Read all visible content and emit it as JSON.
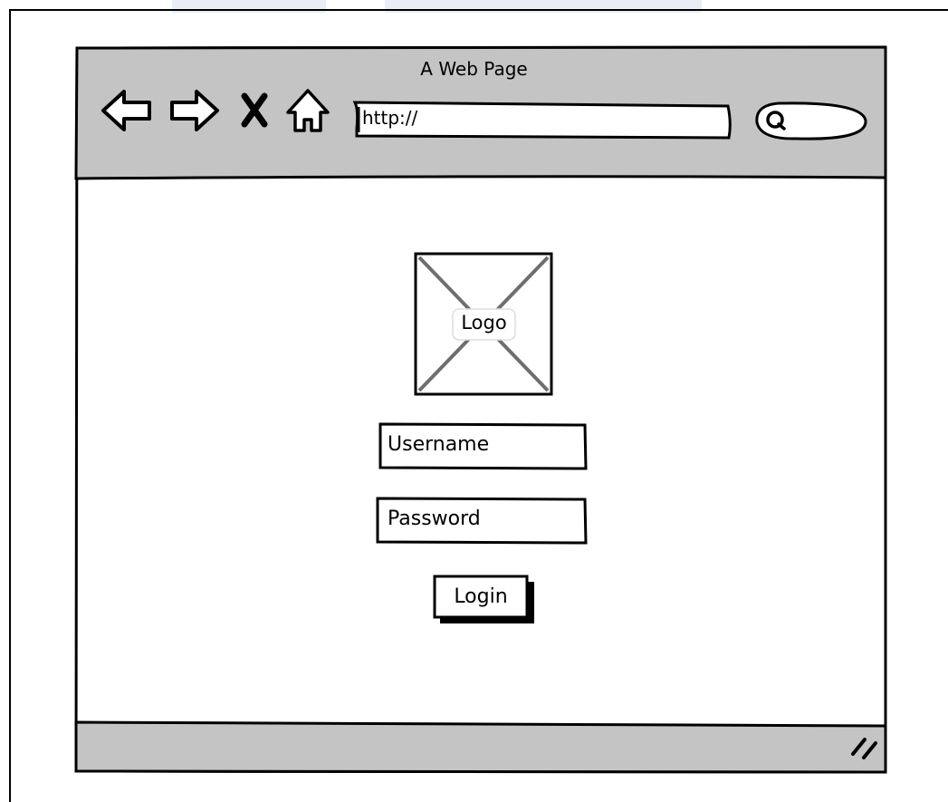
{
  "window": {
    "title": "A Web Page"
  },
  "toolbar": {
    "address": "http://",
    "icons": [
      "back-arrow-icon",
      "forward-arrow-icon",
      "close-x-icon",
      "home-icon",
      "search-icon"
    ]
  },
  "login": {
    "logo_label": "Logo",
    "username_value": "Username",
    "password_value": "Password",
    "login_label": "Login"
  },
  "colors": {
    "chrome_gray": "#c4c4c4",
    "stroke": "#000000",
    "placeholder_x": "#6e6e6e",
    "top_band": "#e9eef6"
  }
}
